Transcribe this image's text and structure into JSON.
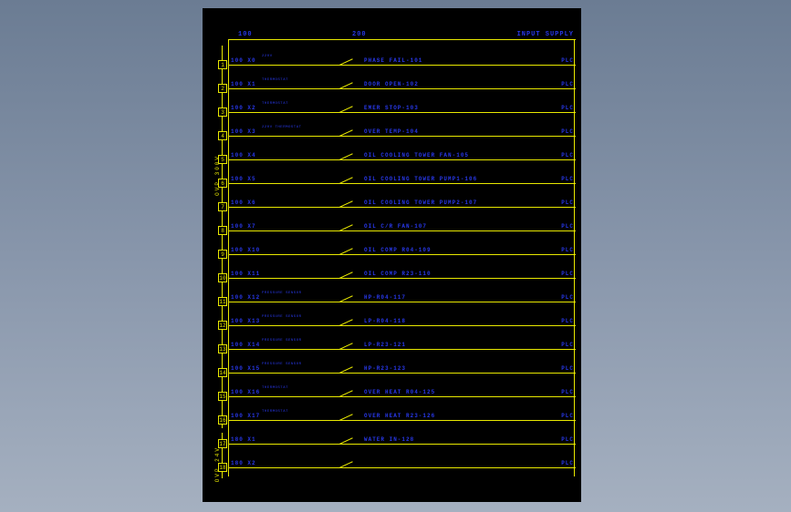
{
  "header": {
    "col1": "100",
    "col2": "200",
    "right": "INPUT SUPPLY"
  },
  "side_labels": {
    "upper": "OVP 300V",
    "lower": "OVP 24V"
  },
  "rungs": [
    {
      "num": "1",
      "left": "100 X0",
      "sub": "220V",
      "mid": "PHASE FAIL-101",
      "right": "PLC"
    },
    {
      "num": "2",
      "left": "100 X1",
      "sub": "THERMOSTAT",
      "mid": "DOOR OPEN-102",
      "right": "PLC"
    },
    {
      "num": "3",
      "left": "100 X2",
      "sub": "THERMOSTAT",
      "mid": "EMER STOP-103",
      "right": "PLC"
    },
    {
      "num": "4",
      "left": "100 X3",
      "sub": "220V THERMOSTAT",
      "mid": "OVER TEMP-104",
      "right": "PLC"
    },
    {
      "num": "5",
      "left": "100 X4",
      "sub": "",
      "mid": "OIL COOLING TOWER FAN-105",
      "right": "PLC"
    },
    {
      "num": "6",
      "left": "100 X5",
      "sub": "",
      "mid": "OIL COOLING TOWER PUMP1-106",
      "right": "PLC"
    },
    {
      "num": "7",
      "left": "100 X6",
      "sub": "",
      "mid": "OIL COOLING TOWER PUMP2-107",
      "right": "PLC"
    },
    {
      "num": "8",
      "left": "100 X7",
      "sub": "",
      "mid": "OIL C/R FAN-107",
      "right": "PLC"
    },
    {
      "num": "9",
      "left": "100 X10",
      "sub": "",
      "mid": "OIL COMP R04-109",
      "right": "PLC"
    },
    {
      "num": "10",
      "left": "100 X11",
      "sub": "",
      "mid": "OIL COMP R23-110",
      "right": "PLC"
    },
    {
      "num": "11",
      "left": "100 X12",
      "sub": "PRESSURE SENSOR",
      "mid": "HP-R04-117",
      "right": "PLC"
    },
    {
      "num": "12",
      "left": "100 X13",
      "sub": "PRESSURE SENSOR",
      "mid": "LP-R04-118",
      "right": "PLC"
    },
    {
      "num": "13",
      "left": "100 X14",
      "sub": "PRESSURE SENSOR",
      "mid": "LP-R23-121",
      "right": "PLC"
    },
    {
      "num": "14",
      "left": "100 X15",
      "sub": "PRESSURE SENSOR",
      "mid": "HP-R23-123",
      "right": "PLC"
    },
    {
      "num": "15",
      "left": "100 X16",
      "sub": "THERMOSTAT",
      "mid": "OVER HEAT R04-125",
      "right": "PLC"
    },
    {
      "num": "16",
      "left": "100 X17",
      "sub": "THERMOSTAT",
      "mid": "OVER HEAT R23-126",
      "right": "PLC"
    },
    {
      "num": "17",
      "left": "180 X1",
      "sub": "",
      "mid": "WATER IN-128",
      "right": "PLC"
    },
    {
      "num": "18",
      "left": "180 X2",
      "sub": "",
      "mid": "",
      "right": "PLC"
    }
  ]
}
